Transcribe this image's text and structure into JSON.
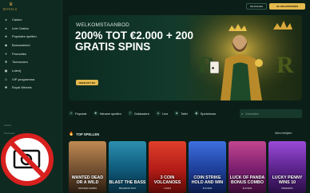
{
  "brand": {
    "name": "ROYALS",
    "color": "#c9a24a"
  },
  "sidebar": {
    "items": [
      {
        "icon": "casino-icon",
        "label": "Casino"
      },
      {
        "icon": "live-casino-icon",
        "label": "Live Casino"
      },
      {
        "icon": "popular-games-icon",
        "label": "Populaire spellen"
      },
      {
        "icon": "bonus-icon",
        "label": "Bonuswinkel"
      },
      {
        "icon": "promotions-icon",
        "label": "Promoties"
      },
      {
        "icon": "tournaments-icon",
        "label": "Toernooien"
      },
      {
        "icon": "lottery-icon",
        "label": "Loterij"
      },
      {
        "icon": "vip-icon",
        "label": "VIP-programma"
      },
      {
        "icon": "wheel-icon",
        "label": "Royal Wheels"
      }
    ],
    "section_label": "Casino",
    "sub_label": "Promoties"
  },
  "header": {
    "login_label": "INLOGGEN",
    "register_label": "NU REGISTREREN"
  },
  "banner": {
    "eyebrow": "WELKOMSTAANBOD",
    "headline": "200% TOT €2.000 + 200 GRATIS SPINS",
    "cta_label": "NEEM HET NU"
  },
  "filters": [
    {
      "icon": "rocket-icon",
      "label": "Populair"
    },
    {
      "icon": "new-icon",
      "label": "Nieuwe spellen"
    },
    {
      "icon": "slots-icon",
      "label": "Gokkasten"
    },
    {
      "icon": "live-icon",
      "label": "Live"
    },
    {
      "icon": "table-icon",
      "label": "Tafel"
    },
    {
      "icon": "gameshow-icon",
      "label": "Spelshows"
    }
  ],
  "search": {
    "placeholder": "Zoekacties"
  },
  "top_games": {
    "heading": "TOP SPELLEN",
    "see_all": "Alles bekijken",
    "items": [
      {
        "title": "WANTED DEAD OR A WILD",
        "provider": "HACKSAW GAMING",
        "color": "#6b4a2e"
      },
      {
        "title": "BLAST THE BASS",
        "provider": "PRAGMATIC PLAY",
        "color": "#0f5a7a"
      },
      {
        "title": "3 COIN VOLCANOES",
        "provider": "3 OAKS",
        "color": "#b31c17"
      },
      {
        "title": "COIN STRIKE HOLD AND WIN",
        "provider": "PLAYSON",
        "color": "#1e3f9a"
      },
      {
        "title": "LUCK OF PANDA BONUS COMBO",
        "provider": "PLAYSON",
        "color": "#7a1f6e"
      },
      {
        "title": "LUCKY PENNY WINS 10",
        "provider": "PRAGMATIC",
        "color": "#5a238a"
      }
    ]
  }
}
